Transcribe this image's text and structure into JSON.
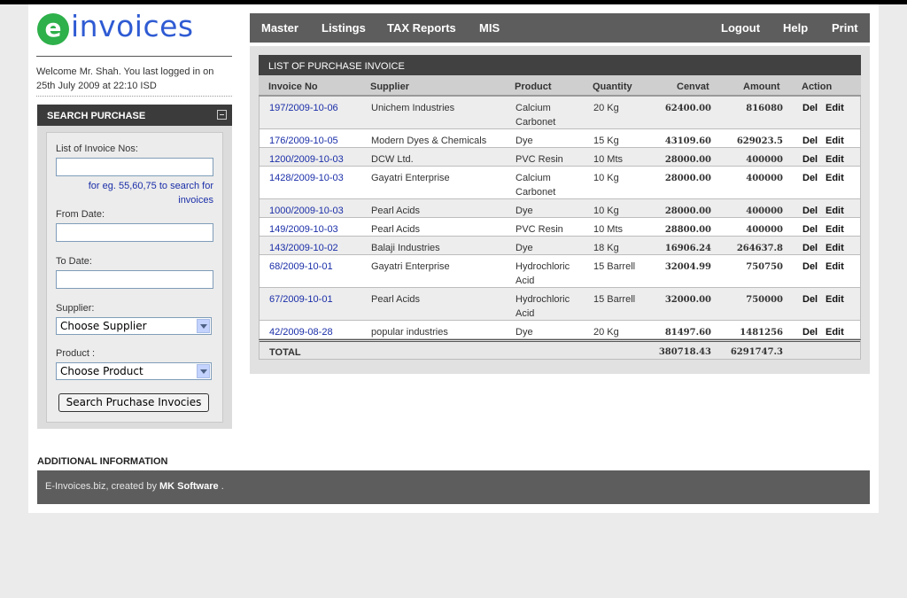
{
  "logo": {
    "letter": "e",
    "text": "invoices"
  },
  "welcome": "Welcome Mr. Shah. You last logged in on 25th July 2009 at 22:10 ISD",
  "search": {
    "title": "SEARCH PURCHASE",
    "invoice_nos_label": "List of Invoice Nos:",
    "invoice_nos_value": "",
    "hint": "for eg. 55,60,75 to search for invoices",
    "from_label": "From Date:",
    "from_value": "",
    "to_label": "To Date:",
    "to_value": "",
    "supplier_label": "Supplier:",
    "supplier_selected": "Choose Supplier",
    "product_label": "Product :",
    "product_selected": "Choose Product",
    "button": "Search Pruchase Invocies"
  },
  "nav": {
    "left": [
      "Master",
      "Listings",
      "TAX Reports",
      "MIS"
    ],
    "right": [
      "Logout",
      "Help",
      "Print"
    ]
  },
  "panel_title": "LIST OF PURCHASE INVOICE",
  "columns": [
    "Invoice No",
    "Supplier",
    "Product",
    "Quantity",
    "Cenvat",
    "Amount",
    "Action"
  ],
  "rows": [
    {
      "inv": "197/2009-10-06",
      "supplier": "Unichem Industries",
      "product": "Calcium Carbonet",
      "qty": "20 Kg",
      "cenvat": "62400.00",
      "amount": "816080",
      "del": "Del",
      "edit": "Edit"
    },
    {
      "inv": "176/2009-10-05",
      "supplier": "Modern Dyes & Chemicals",
      "product": "Dye",
      "qty": "15 Kg",
      "cenvat": "43109.60",
      "amount": "629023.5",
      "del": "Del",
      "edit": "Edit"
    },
    {
      "inv": "1200/2009-10-03",
      "supplier": "DCW Ltd.",
      "product": "PVC Resin",
      "qty": "10 Mts",
      "cenvat": "28000.00",
      "amount": "400000",
      "del": "Del",
      "edit": "Edit"
    },
    {
      "inv": "1428/2009-10-03",
      "supplier": "Gayatri Enterprise",
      "product": "Calcium Carbonet",
      "qty": "10 Kg",
      "cenvat": "28000.00",
      "amount": "400000",
      "del": "Del",
      "edit": "Edit"
    },
    {
      "inv": "1000/2009-10-03",
      "supplier": "Pearl Acids",
      "product": "Dye",
      "qty": "10 Kg",
      "cenvat": "28000.00",
      "amount": "400000",
      "del": "Del",
      "edit": "Edit"
    },
    {
      "inv": "149/2009-10-03",
      "supplier": "Pearl Acids",
      "product": "PVC Resin",
      "qty": "10 Mts",
      "cenvat": "28800.00",
      "amount": "400000",
      "del": "Del",
      "edit": "Edit"
    },
    {
      "inv": "143/2009-10-02",
      "supplier": "Balaji Industries",
      "product": "Dye",
      "qty": "18 Kg",
      "cenvat": "16906.24",
      "amount": "264637.8",
      "del": "Del",
      "edit": "Edit"
    },
    {
      "inv": "68/2009-10-01",
      "supplier": "Gayatri Enterprise",
      "product": "Hydrochloric Acid",
      "qty": "15 Barrell",
      "cenvat": "32004.99",
      "amount": "750750",
      "del": "Del",
      "edit": "Edit"
    },
    {
      "inv": "67/2009-10-01",
      "supplier": "Pearl Acids",
      "product": "Hydrochloric Acid",
      "qty": "15 Barrell",
      "cenvat": "32000.00",
      "amount": "750000",
      "del": "Del",
      "edit": "Edit"
    },
    {
      "inv": "42/2009-08-28",
      "supplier": "popular industries",
      "product": "Dye",
      "qty": "20 Kg",
      "cenvat": "81497.60",
      "amount": "1481256",
      "del": "Del",
      "edit": "Edit"
    }
  ],
  "total": {
    "label": "TOTAL",
    "cenvat": "380718.43",
    "amount": "6291747.3"
  },
  "additional_info": "ADDITIONAL INFORMATION",
  "footer": {
    "prefix": "E-Invoices.biz, created by",
    "company": "MK Software",
    "suffix": "."
  }
}
